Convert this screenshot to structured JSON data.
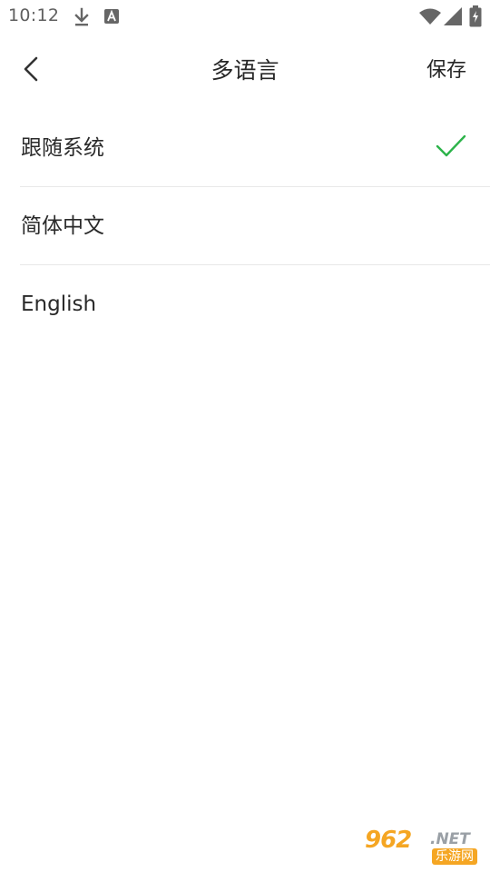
{
  "status_bar": {
    "time": "10:12",
    "left_icons": [
      "download-icon",
      "font-a-icon"
    ],
    "right_icons": [
      "wifi-icon",
      "signal-icon",
      "battery-charging-icon"
    ]
  },
  "header": {
    "title": "多语言",
    "save_label": "保存",
    "back_icon": "chevron-left-icon"
  },
  "languages": [
    {
      "label": "跟随系统",
      "selected": true
    },
    {
      "label": "简体中文",
      "selected": false
    },
    {
      "label": "English",
      "selected": false
    }
  ],
  "colors": {
    "check": "#2cb34a",
    "text": "#262626",
    "divider": "#e8e8e8",
    "watermark": "#f5a623"
  },
  "watermark": {
    "brand": "962",
    "domain": ".NET",
    "cn_text": "乐游网"
  }
}
